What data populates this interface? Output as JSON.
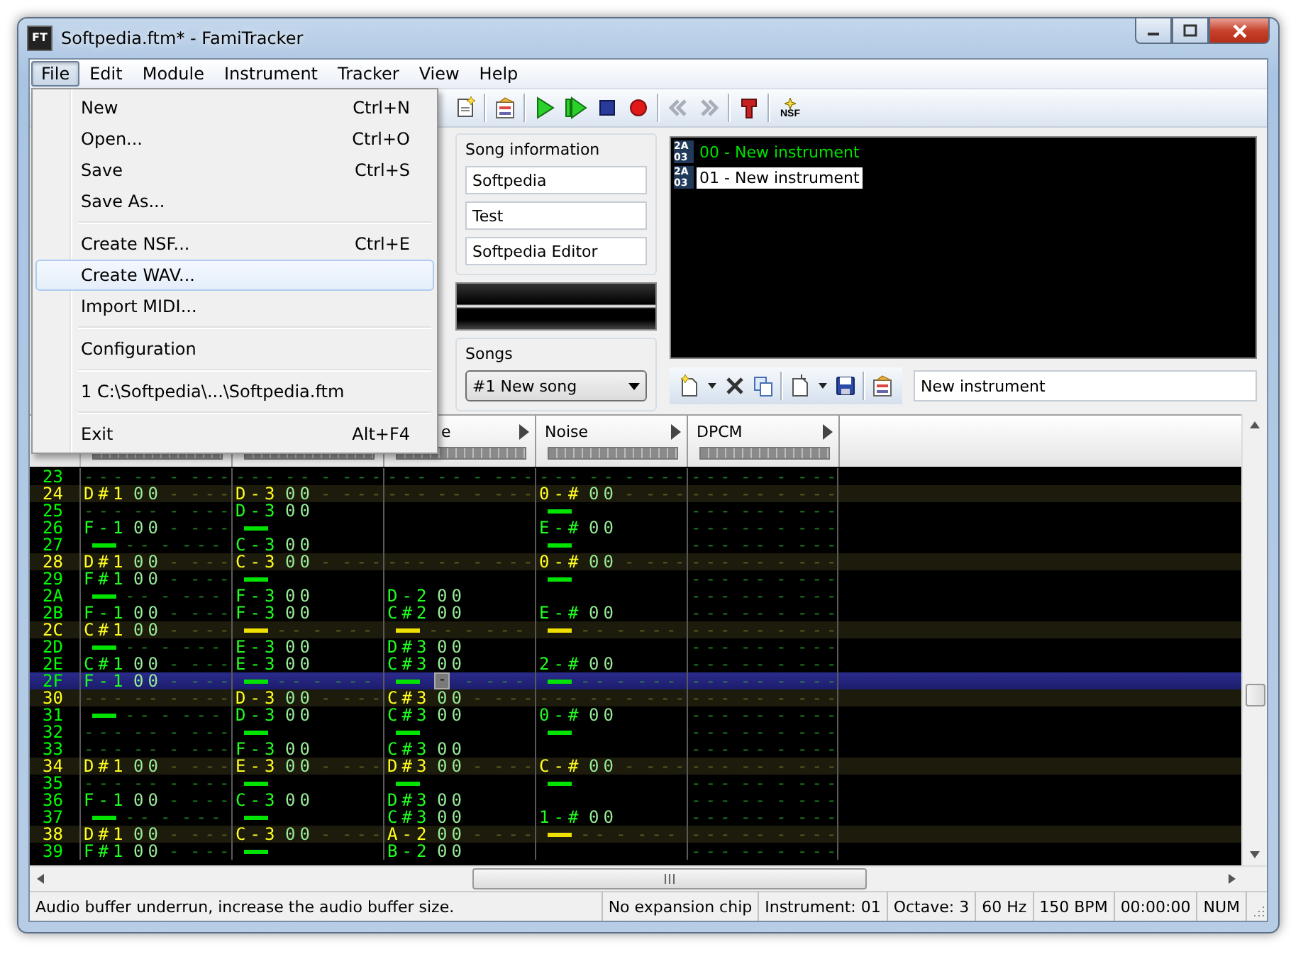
{
  "window": {
    "title": "Softpedia.ftm* - FamiTracker",
    "icon_text": "FT"
  },
  "menubar": [
    {
      "label": "File",
      "selected": true
    },
    {
      "label": "Edit",
      "selected": false
    },
    {
      "label": "Module",
      "selected": false
    },
    {
      "label": "Instrument",
      "selected": false
    },
    {
      "label": "Tracker",
      "selected": false
    },
    {
      "label": "View",
      "selected": false
    },
    {
      "label": "Help",
      "selected": false
    }
  ],
  "file_menu": [
    {
      "kind": "item",
      "label": "New",
      "shortcut": "Ctrl+N",
      "selected": false
    },
    {
      "kind": "item",
      "label": "Open...",
      "shortcut": "Ctrl+O",
      "selected": false
    },
    {
      "kind": "item",
      "label": "Save",
      "shortcut": "Ctrl+S",
      "selected": false
    },
    {
      "kind": "item",
      "label": "Save As...",
      "selected": false
    },
    {
      "kind": "separator"
    },
    {
      "kind": "item",
      "label": "Create NSF...",
      "shortcut": "Ctrl+E",
      "selected": false
    },
    {
      "kind": "item",
      "label": "Create WAV...",
      "selected": true
    },
    {
      "kind": "item",
      "label": "Import MIDI...",
      "selected": false
    },
    {
      "kind": "separator"
    },
    {
      "kind": "item",
      "label": "Configuration",
      "selected": false
    },
    {
      "kind": "separator"
    },
    {
      "kind": "item",
      "label": "1 C:\\Softpedia\\...\\Softpedia.ftm",
      "selected": false
    },
    {
      "kind": "separator"
    },
    {
      "kind": "item",
      "label": "Exit",
      "shortcut": "Alt+F4",
      "selected": false
    }
  ],
  "toolbar": [
    {
      "kind": "new-document",
      "disabled": false
    },
    {
      "kind": "separator"
    },
    {
      "kind": "properties",
      "disabled": false
    },
    {
      "kind": "separator"
    },
    {
      "kind": "play",
      "disabled": false
    },
    {
      "kind": "play-pattern",
      "disabled": false
    },
    {
      "kind": "stop",
      "disabled": false
    },
    {
      "kind": "record",
      "disabled": false
    },
    {
      "kind": "separator"
    },
    {
      "kind": "previous",
      "disabled": true
    },
    {
      "kind": "next",
      "disabled": true
    },
    {
      "kind": "separator"
    },
    {
      "kind": "settings",
      "disabled": false
    },
    {
      "kind": "separator"
    },
    {
      "kind": "nsf",
      "label": "NSF",
      "disabled": false
    }
  ],
  "song_information": {
    "title": "Song information",
    "fields": [
      {
        "value": "Softpedia"
      },
      {
        "value": "Test"
      },
      {
        "value": "Softpedia Editor"
      }
    ]
  },
  "songs": {
    "title": "Songs",
    "selected_song": "#1 New song"
  },
  "instruments": [
    {
      "chip": [
        "2A",
        "03"
      ],
      "label": "00 - New instrument",
      "selected": false
    },
    {
      "chip": [
        "2A",
        "03"
      ],
      "label": "01 - New instrument",
      "selected": true
    }
  ],
  "instrument_toolbar": [
    {
      "kind": "new"
    },
    {
      "kind": "dropdown"
    },
    {
      "kind": "delete"
    },
    {
      "kind": "clone"
    },
    {
      "kind": "separator"
    },
    {
      "kind": "load"
    },
    {
      "kind": "dropdown"
    },
    {
      "kind": "save"
    },
    {
      "kind": "separator"
    },
    {
      "kind": "edit"
    }
  ],
  "instrument_name": {
    "value": "New instrument"
  },
  "pattern": {
    "channels": [
      {
        "label": "e",
        "clipped": true
      },
      {
        "label": "Noise",
        "clipped": false
      },
      {
        "label": "DPCM",
        "clipped": false
      }
    ],
    "rows": [
      {
        "number": "23",
        "highlight": false,
        "selected": false,
        "cells": [
          {
            "kind": "empty",
            "text": [
              "---",
              "--",
              "-",
              "---"
            ]
          },
          {
            "kind": "empty",
            "text": [
              "---",
              "--",
              "-",
              "---"
            ]
          },
          {
            "kind": "empty",
            "text": [
              "---",
              "--",
              "-",
              "---"
            ]
          },
          {
            "kind": "empty",
            "text": [
              "---",
              "--",
              "-",
              "---"
            ]
          },
          {
            "kind": "empty",
            "text": [
              "---",
              "--",
              "-",
              "---"
            ]
          }
        ]
      },
      {
        "number": "24",
        "highlight": true,
        "selected": false,
        "cells": [
          {
            "kind": "note",
            "text": [
              "D#1",
              "00",
              "-",
              "---"
            ]
          },
          {
            "kind": "note",
            "text": [
              "D-3",
              "00",
              "-",
              "---"
            ]
          },
          {
            "kind": "empty",
            "text": [
              "---",
              "--",
              "-",
              "---"
            ]
          },
          {
            "kind": "note",
            "text": [
              "0-#",
              "00",
              "-",
              "---"
            ]
          },
          {
            "kind": "empty",
            "text": [
              "---",
              "--",
              "-",
              "---"
            ]
          }
        ]
      },
      {
        "number": "25",
        "highlight": false,
        "selected": false,
        "cells": [
          {
            "kind": "empty",
            "text": [
              "---",
              "--",
              "-",
              "---"
            ]
          },
          {
            "kind": "note",
            "text": [
              "D-3",
              "00"
            ]
          },
          {
            "kind": "blank"
          },
          {
            "kind": "cut"
          },
          {
            "kind": "empty",
            "text": [
              "---",
              "--",
              "-",
              "---"
            ]
          }
        ]
      },
      {
        "number": "26",
        "highlight": false,
        "selected": false,
        "cells": [
          {
            "kind": "note",
            "text": [
              "F-1",
              "00",
              "-",
              "---"
            ]
          },
          {
            "kind": "cut"
          },
          {
            "kind": "blank"
          },
          {
            "kind": "note",
            "text": [
              "E-#",
              "00"
            ]
          },
          {
            "kind": "empty",
            "text": [
              "---",
              "--",
              "-",
              "---"
            ]
          }
        ]
      },
      {
        "number": "27",
        "highlight": false,
        "selected": false,
        "cells": [
          {
            "kind": "cut",
            "text": [
              "--",
              "-",
              "---"
            ]
          },
          {
            "kind": "note",
            "text": [
              "C-3",
              "00"
            ]
          },
          {
            "kind": "blank"
          },
          {
            "kind": "cut"
          },
          {
            "kind": "empty",
            "text": [
              "---",
              "--",
              "-",
              "---"
            ]
          }
        ]
      },
      {
        "number": "28",
        "highlight": true,
        "selected": false,
        "cells": [
          {
            "kind": "note",
            "text": [
              "D#1",
              "00",
              "-",
              "---"
            ]
          },
          {
            "kind": "note",
            "text": [
              "C-3",
              "00",
              "-",
              "---"
            ]
          },
          {
            "kind": "empty",
            "text": [
              "---",
              "--",
              "-",
              "---"
            ]
          },
          {
            "kind": "note",
            "text": [
              "0-#",
              "00",
              "-",
              "---"
            ]
          },
          {
            "kind": "empty",
            "text": [
              "---",
              "--",
              "-",
              "---"
            ]
          }
        ]
      },
      {
        "number": "29",
        "highlight": false,
        "selected": false,
        "cells": [
          {
            "kind": "note",
            "text": [
              "F#1",
              "00",
              "-",
              "---"
            ]
          },
          {
            "kind": "cut"
          },
          {
            "kind": "blank"
          },
          {
            "kind": "cut"
          },
          {
            "kind": "empty",
            "text": [
              "---",
              "--",
              "-",
              "---"
            ]
          }
        ]
      },
      {
        "number": "2A",
        "highlight": false,
        "selected": false,
        "cells": [
          {
            "kind": "cut",
            "text": [
              "--",
              "-",
              "---"
            ]
          },
          {
            "kind": "note",
            "text": [
              "F-3",
              "00"
            ]
          },
          {
            "kind": "note",
            "text": [
              "D-2",
              "00"
            ]
          },
          {
            "kind": "blank"
          },
          {
            "kind": "empty",
            "text": [
              "---",
              "--",
              "-",
              "---"
            ]
          }
        ]
      },
      {
        "number": "2B",
        "highlight": false,
        "selected": false,
        "cells": [
          {
            "kind": "note",
            "text": [
              "F-1",
              "00",
              "-",
              "---"
            ]
          },
          {
            "kind": "note",
            "text": [
              "F-3",
              "00"
            ]
          },
          {
            "kind": "note",
            "text": [
              "C#2",
              "00"
            ]
          },
          {
            "kind": "note",
            "text": [
              "E-#",
              "00"
            ]
          },
          {
            "kind": "empty",
            "text": [
              "---",
              "--",
              "-",
              "---"
            ]
          }
        ]
      },
      {
        "number": "2C",
        "highlight": true,
        "selected": false,
        "cells": [
          {
            "kind": "note",
            "text": [
              "C#1",
              "00",
              "-",
              "---"
            ]
          },
          {
            "kind": "cut",
            "text": [
              "--",
              "-",
              "---"
            ]
          },
          {
            "kind": "cut",
            "text": [
              "--",
              "-",
              "---"
            ]
          },
          {
            "kind": "cut",
            "text": [
              "--",
              "-",
              "---"
            ]
          },
          {
            "kind": "empty",
            "text": [
              "---",
              "--",
              "-",
              "---"
            ]
          }
        ]
      },
      {
        "number": "2D",
        "highlight": false,
        "selected": false,
        "cells": [
          {
            "kind": "cut",
            "text": [
              "--",
              "-",
              "---"
            ]
          },
          {
            "kind": "note",
            "text": [
              "E-3",
              "00"
            ]
          },
          {
            "kind": "note",
            "text": [
              "D#3",
              "00"
            ]
          },
          {
            "kind": "blank"
          },
          {
            "kind": "empty",
            "text": [
              "---",
              "--",
              "-",
              "---"
            ]
          }
        ]
      },
      {
        "number": "2E",
        "highlight": false,
        "selected": false,
        "cells": [
          {
            "kind": "note",
            "text": [
              "C#1",
              "00",
              "-",
              "---"
            ]
          },
          {
            "kind": "note",
            "text": [
              "E-3",
              "00"
            ]
          },
          {
            "kind": "note",
            "text": [
              "C#3",
              "00"
            ]
          },
          {
            "kind": "note",
            "text": [
              "2-#",
              "00"
            ]
          },
          {
            "kind": "empty",
            "text": [
              "---",
              "--",
              "-",
              "---"
            ]
          }
        ]
      },
      {
        "number": "2F",
        "highlight": false,
        "selected": true,
        "cells": [
          {
            "kind": "note",
            "text": [
              "F-1",
              "00",
              "-",
              "---"
            ]
          },
          {
            "kind": "cut",
            "text": [
              "--",
              "-",
              "---"
            ]
          },
          {
            "kind": "cut",
            "cursor": "-",
            "text": [
              "-",
              "---"
            ]
          },
          {
            "kind": "cut",
            "text": [
              "--",
              "-",
              "---"
            ]
          },
          {
            "kind": "empty",
            "text": [
              "---",
              "--",
              "-",
              "---"
            ]
          }
        ]
      },
      {
        "number": "30",
        "highlight": true,
        "selected": false,
        "cells": [
          {
            "kind": "empty",
            "text": [
              "---",
              "--",
              "-",
              "---"
            ]
          },
          {
            "kind": "note",
            "text": [
              "D-3",
              "00",
              "-",
              "---"
            ]
          },
          {
            "kind": "note",
            "text": [
              "C#3",
              "00",
              "-",
              "---"
            ]
          },
          {
            "kind": "empty",
            "text": [
              "---",
              "--",
              "-",
              "---"
            ]
          },
          {
            "kind": "empty",
            "text": [
              "---",
              "--",
              "-",
              "---"
            ]
          }
        ]
      },
      {
        "number": "31",
        "highlight": false,
        "selected": false,
        "cells": [
          {
            "kind": "cut",
            "text": [
              "--",
              "-",
              "---"
            ]
          },
          {
            "kind": "note",
            "text": [
              "D-3",
              "00"
            ]
          },
          {
            "kind": "note",
            "text": [
              "C#3",
              "00"
            ]
          },
          {
            "kind": "note",
            "text": [
              "0-#",
              "00"
            ]
          },
          {
            "kind": "empty",
            "text": [
              "---",
              "--",
              "-",
              "---"
            ]
          }
        ]
      },
      {
        "number": "32",
        "highlight": false,
        "selected": false,
        "cells": [
          {
            "kind": "empty",
            "text": [
              "---",
              "--",
              "-",
              "---"
            ]
          },
          {
            "kind": "cut"
          },
          {
            "kind": "cut"
          },
          {
            "kind": "cut"
          },
          {
            "kind": "empty",
            "text": [
              "---",
              "--",
              "-",
              "---"
            ]
          }
        ]
      },
      {
        "number": "33",
        "highlight": false,
        "selected": false,
        "cells": [
          {
            "kind": "empty",
            "text": [
              "---",
              "--",
              "-",
              "---"
            ]
          },
          {
            "kind": "note",
            "text": [
              "F-3",
              "00"
            ]
          },
          {
            "kind": "note",
            "text": [
              "C#3",
              "00"
            ]
          },
          {
            "kind": "blank"
          },
          {
            "kind": "empty",
            "text": [
              "---",
              "--",
              "-",
              "---"
            ]
          }
        ]
      },
      {
        "number": "34",
        "highlight": true,
        "selected": false,
        "cells": [
          {
            "kind": "note",
            "text": [
              "D#1",
              "00",
              "-",
              "---"
            ]
          },
          {
            "kind": "note",
            "text": [
              "E-3",
              "00",
              "-",
              "---"
            ]
          },
          {
            "kind": "note",
            "text": [
              "D#3",
              "00",
              "-",
              "---"
            ]
          },
          {
            "kind": "note",
            "text": [
              "C-#",
              "00",
              "-",
              "---"
            ]
          },
          {
            "kind": "empty",
            "text": [
              "---",
              "--",
              "-",
              "---"
            ]
          }
        ]
      },
      {
        "number": "35",
        "highlight": false,
        "selected": false,
        "cells": [
          {
            "kind": "empty",
            "text": [
              "---",
              "--",
              "-",
              "---"
            ]
          },
          {
            "kind": "cut"
          },
          {
            "kind": "cut"
          },
          {
            "kind": "cut"
          },
          {
            "kind": "empty",
            "text": [
              "---",
              "--",
              "-",
              "---"
            ]
          }
        ]
      },
      {
        "number": "36",
        "highlight": false,
        "selected": false,
        "cells": [
          {
            "kind": "note",
            "text": [
              "F-1",
              "00",
              "-",
              "---"
            ]
          },
          {
            "kind": "note",
            "text": [
              "C-3",
              "00"
            ]
          },
          {
            "kind": "note",
            "text": [
              "D#3",
              "00"
            ]
          },
          {
            "kind": "blank"
          },
          {
            "kind": "empty",
            "text": [
              "---",
              "--",
              "-",
              "---"
            ]
          }
        ]
      },
      {
        "number": "37",
        "highlight": false,
        "selected": false,
        "cells": [
          {
            "kind": "cut",
            "text": [
              "--",
              "-",
              "---"
            ]
          },
          {
            "kind": "cut"
          },
          {
            "kind": "note",
            "text": [
              "C#3",
              "00"
            ]
          },
          {
            "kind": "note",
            "text": [
              "1-#",
              "00"
            ]
          },
          {
            "kind": "empty",
            "text": [
              "---",
              "--",
              "-",
              "---"
            ]
          }
        ]
      },
      {
        "number": "38",
        "highlight": true,
        "selected": false,
        "cells": [
          {
            "kind": "note",
            "text": [
              "D#1",
              "00",
              "-",
              "---"
            ]
          },
          {
            "kind": "note",
            "text": [
              "C-3",
              "00",
              "-",
              "---"
            ]
          },
          {
            "kind": "note",
            "text": [
              "A-2",
              "00",
              "-",
              "---"
            ]
          },
          {
            "kind": "cut",
            "text": [
              "--",
              "-",
              "---"
            ]
          },
          {
            "kind": "empty",
            "text": [
              "---",
              "--",
              "-",
              "---"
            ]
          }
        ]
      },
      {
        "number": "39",
        "highlight": false,
        "selected": false,
        "cells": [
          {
            "kind": "note",
            "text": [
              "F#1",
              "00",
              "-",
              "---"
            ]
          },
          {
            "kind": "cut"
          },
          {
            "kind": "note",
            "text": [
              "B-2",
              "00"
            ]
          },
          {
            "kind": "blank"
          },
          {
            "kind": "empty",
            "text": [
              "---",
              "--",
              "-",
              "---"
            ]
          }
        ]
      }
    ]
  },
  "status_bar": [
    "Audio buffer underrun, increase the audio buffer size.",
    "No expansion chip",
    "Instrument: 01",
    "Octave: 3",
    "60 Hz",
    "150 BPM",
    "00:00:00",
    "NUM"
  ]
}
